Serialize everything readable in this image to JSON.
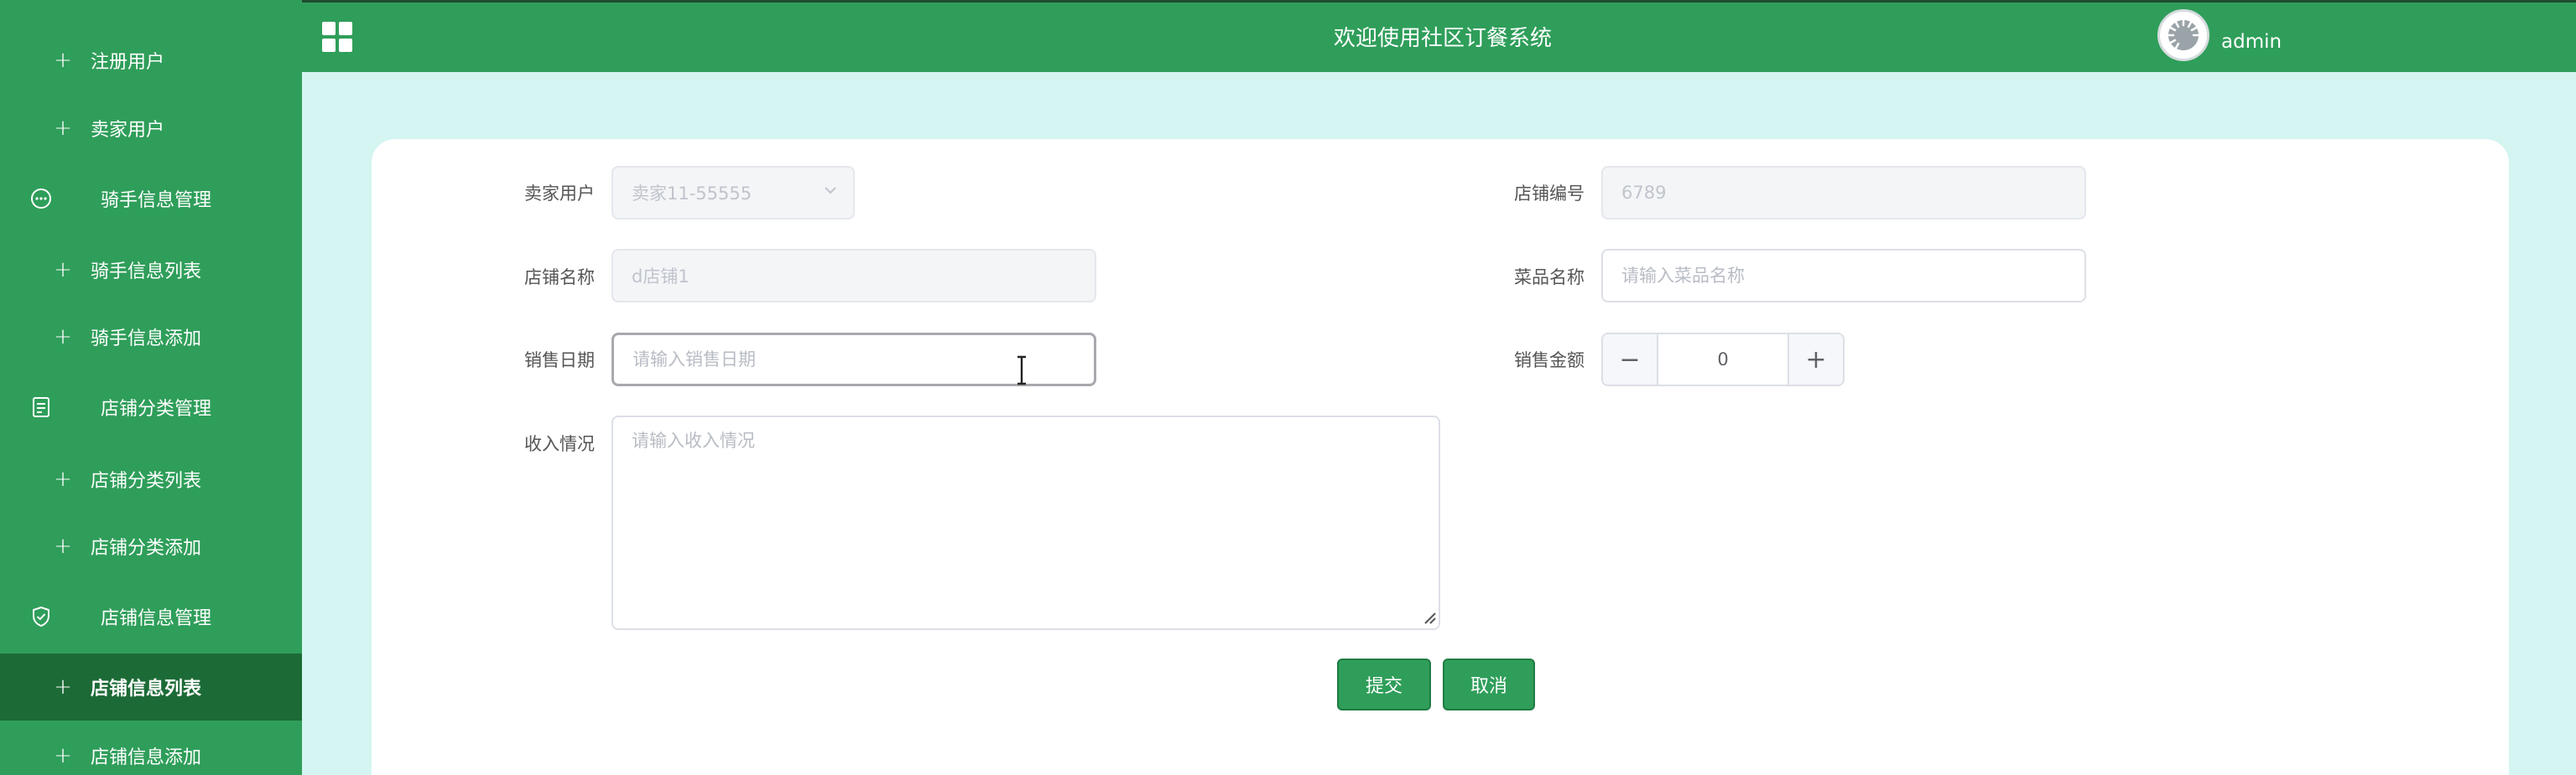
{
  "header": {
    "title": "欢迎使用社区订餐系统",
    "username": "admin"
  },
  "sidebar": {
    "items": [
      {
        "type": "sub",
        "label": "注册用户"
      },
      {
        "type": "sub",
        "label": "卖家用户"
      },
      {
        "type": "group",
        "label": "骑手信息管理",
        "icon": "chat-bubble-icon"
      },
      {
        "type": "sub",
        "label": "骑手信息列表"
      },
      {
        "type": "sub",
        "label": "骑手信息添加"
      },
      {
        "type": "group",
        "label": "店铺分类管理",
        "icon": "document-icon"
      },
      {
        "type": "sub",
        "label": "店铺分类列表"
      },
      {
        "type": "sub",
        "label": "店铺分类添加"
      },
      {
        "type": "group",
        "label": "店铺信息管理",
        "icon": "shield-check-icon"
      },
      {
        "type": "sub",
        "label": "店铺信息列表",
        "active": true
      },
      {
        "type": "sub",
        "label": "店铺信息添加"
      }
    ]
  },
  "form": {
    "seller": {
      "label": "卖家用户",
      "value": "卖家11-55555"
    },
    "shop_no": {
      "label": "店铺编号",
      "value": "6789"
    },
    "shop_name": {
      "label": "店铺名称",
      "value": "d店铺1"
    },
    "dish_name": {
      "label": "菜品名称",
      "placeholder": "请输入菜品名称"
    },
    "sale_date": {
      "label": "销售日期",
      "placeholder": "请输入销售日期"
    },
    "sale_amount": {
      "label": "销售金额",
      "value": "0",
      "minus": "−",
      "plus": "+"
    },
    "income": {
      "label": "收入情况",
      "placeholder": "请输入收入情况"
    },
    "submit_label": "提交",
    "cancel_label": "取消"
  },
  "colors": {
    "brand_green": "#2f9e5a",
    "sidebar_active": "#1c6b36",
    "page_bg": "#d4f5f1"
  }
}
